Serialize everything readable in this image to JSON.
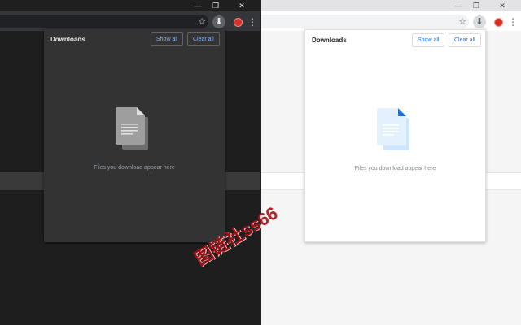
{
  "window": {
    "min_symbol": "—",
    "max_symbol": "❐",
    "close_symbol": "✕"
  },
  "toolbar": {
    "star_icon": "star-icon",
    "download_icon": "download-arrow-icon",
    "extension_icon": "extension-icon",
    "menu_icon": "more-vert-icon",
    "star_glyph": "☆",
    "download_glyph": "⬇",
    "menu_glyph": "⋮"
  },
  "popup": {
    "title": "Downloads",
    "show_all_label": "Show all",
    "clear_all_label": "Clear all",
    "empty_message": "Files you download appear here"
  },
  "watermark": {
    "text": "图链社ss66"
  },
  "colors": {
    "dark_popup_bg": "#333333",
    "light_popup_bg": "#ffffff",
    "dark_accent": "#8ab4f8",
    "light_accent": "#1a73e8",
    "dark_file_icon": "#9e9e9e",
    "light_file_icon": "#cfe5fb",
    "watermark": "#a50f15"
  }
}
